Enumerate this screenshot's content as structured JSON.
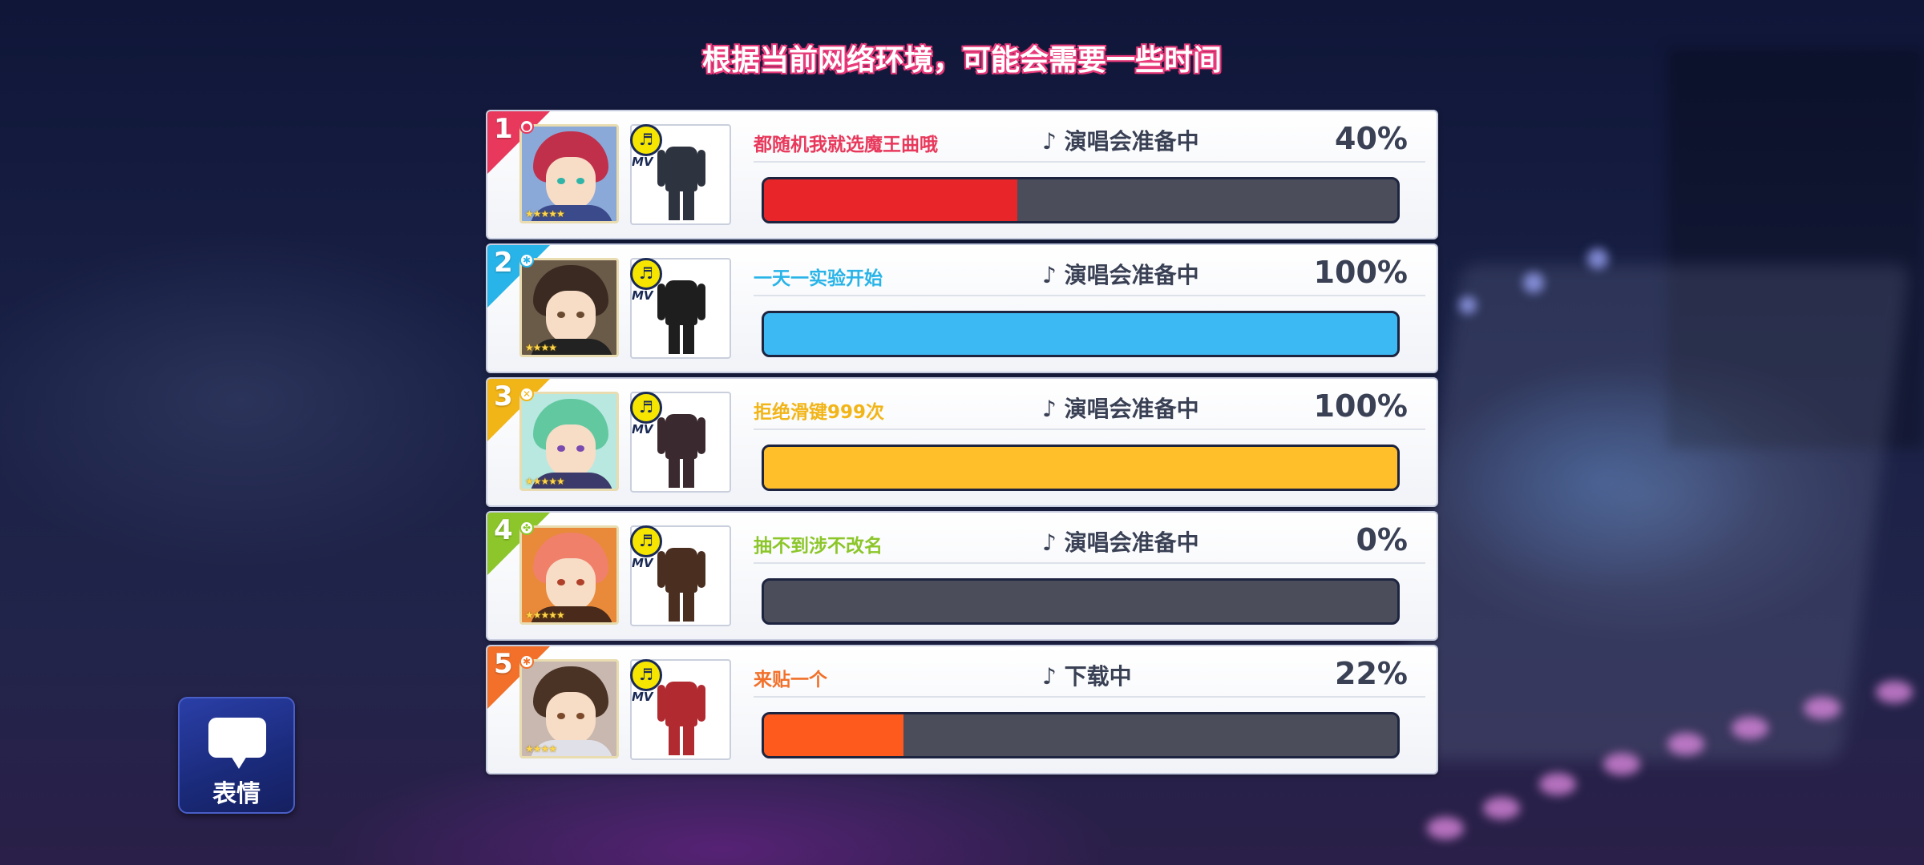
{
  "header": {
    "message": "根据当前网络环境，可能会需要一些时间"
  },
  "players": [
    {
      "rank": "1",
      "attr": "●",
      "name": "都随机我就选魔王曲哦",
      "status": "♪ 演唱会准备中",
      "percent_label": "40%",
      "progress": 0.4,
      "stars": "★★★★★",
      "colors": {
        "accent": "#e8395c",
        "bar": "#e8262a",
        "hair": "#c0304a",
        "eye": "#2fb4a8",
        "cloth": "#3a4a8a",
        "avatar_bg": "#8aa8d8",
        "outfit": "#2e3340"
      }
    },
    {
      "rank": "2",
      "attr": "✱",
      "name": "一天一实验开始",
      "status": "♪ 演唱会准备中",
      "percent_label": "100%",
      "progress": 1.0,
      "stars": "★★★★",
      "colors": {
        "accent": "#28b4e8",
        "bar": "#3cb8f2",
        "hair": "#3a2a22",
        "eye": "#6a4a30",
        "cloth": "#222222",
        "avatar_bg": "#6a5a48",
        "outfit": "#1e1e1e"
      }
    },
    {
      "rank": "3",
      "attr": "✕",
      "name": "拒绝滑键999次",
      "status": "♪ 演唱会准备中",
      "percent_label": "100%",
      "progress": 1.0,
      "stars": "★★★★★",
      "colors": {
        "accent": "#f2b518",
        "bar": "#ffbf2a",
        "hair": "#62c8a0",
        "eye": "#7a4ab0",
        "cloth": "#3c3a6a",
        "avatar_bg": "#b8e8e0",
        "outfit": "#3a2a30"
      }
    },
    {
      "rank": "4",
      "attr": "✤",
      "name": "抽不到涉不改名",
      "status": "♪ 演唱会准备中",
      "percent_label": "0%",
      "progress": 0.0,
      "stars": "★★★★★",
      "colors": {
        "accent": "#8cc62a",
        "bar": "#8cc62a",
        "hair": "#f0806a",
        "eye": "#b0402a",
        "cloth": "#4a2a1a",
        "avatar_bg": "#e88a3a",
        "outfit": "#4a2e20"
      }
    },
    {
      "rank": "5",
      "attr": "✱",
      "name": "来贴一个",
      "status": "♪ 下载中",
      "percent_label": "22%",
      "progress": 0.22,
      "stars": "★★★★",
      "colors": {
        "accent": "#f2702a",
        "bar": "#ff5a1e",
        "hair": "#4a3224",
        "eye": "#7a4a2a",
        "cloth": "#e0e0e8",
        "avatar_bg": "#c8b8b0",
        "outfit": "#b02a30"
      }
    }
  ],
  "outfit_badge": {
    "icon": "♬",
    "label": "MV"
  },
  "emote_button": {
    "label": "表情",
    "icon": "speech-bubble-icon"
  }
}
